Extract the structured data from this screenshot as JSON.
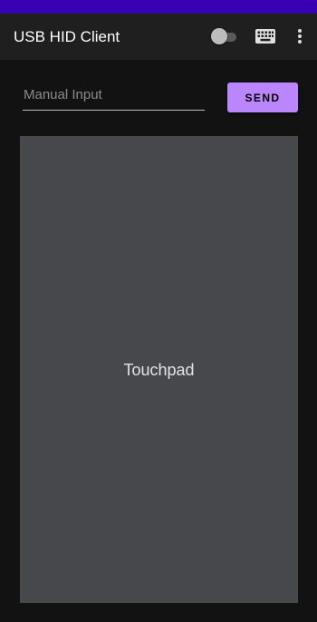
{
  "app_bar": {
    "title": "USB HID Client",
    "toggle_on": false,
    "keyboard_icon": "keyboard-icon",
    "more_icon": "more-vert-icon"
  },
  "input": {
    "value": "",
    "placeholder": "Manual Input"
  },
  "send_button": {
    "label": "SEND"
  },
  "touchpad": {
    "label": "Touchpad"
  },
  "colors": {
    "status_bar": "#3700b3",
    "accent": "#bb86fc",
    "background": "#121212",
    "app_bar": "#1f1f1f",
    "touchpad": "#47484c"
  }
}
